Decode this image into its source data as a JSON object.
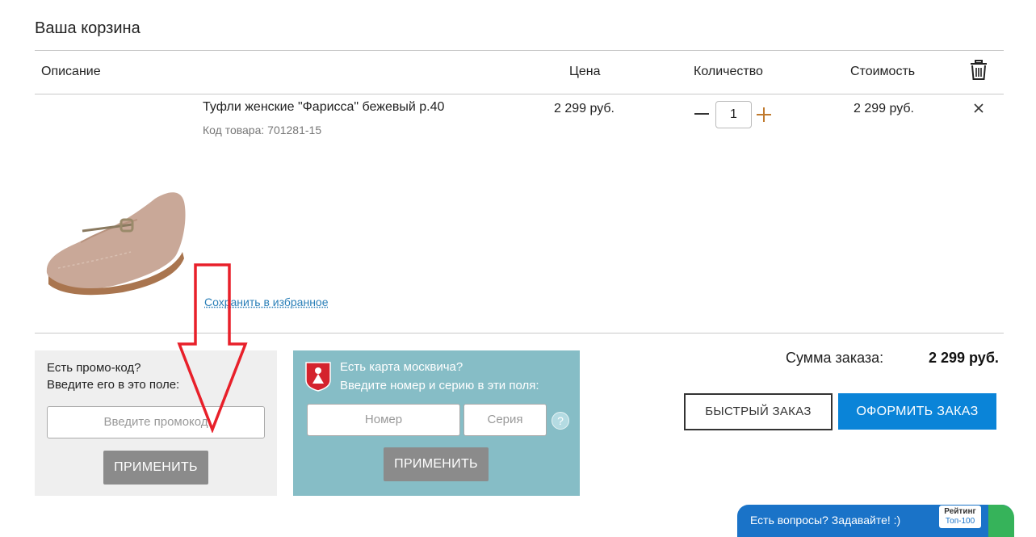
{
  "cart": {
    "title": "Ваша корзина",
    "columns": {
      "description": "Описание",
      "price": "Цена",
      "quantity": "Количество",
      "cost": "Стоимость"
    },
    "item": {
      "name": "Туфли женские \"Фарисса\" бежевый р.40",
      "code": "Код товара: 701281-15",
      "price": "2 299 руб.",
      "quantity": "1",
      "cost": "2 299 руб.",
      "save_to_favorites": "Сохранить в избранное"
    }
  },
  "promo": {
    "line1": "Есть промо-код?",
    "line2": "Введите его в это поле:",
    "placeholder": "Введите промокод",
    "apply": "ПРИМЕНИТЬ"
  },
  "muscovite_card": {
    "line1": "Есть карта москвича?",
    "line2": "Введите номер и серию в эти поля:",
    "number_placeholder": "Номер",
    "series_placeholder": "Серия",
    "help": "?",
    "apply": "ПРИМЕНИТЬ"
  },
  "summary": {
    "label": "Сумма заказа:",
    "value": "2 299 руб.",
    "quick_order": "БЫСТРЫЙ ЗАКАЗ",
    "checkout": "ОФОРМИТЬ ЗАКАЗ"
  },
  "chat": {
    "text": "Есть вопросы? Задавайте! :)",
    "rating_line1": "Рейтинг",
    "rating_line2": "Топ-100"
  },
  "icons": {
    "trash": "trash-icon",
    "remove": "close-icon",
    "plus": "plus-icon",
    "minus": "minus-icon",
    "help": "question-icon",
    "crest": "moscow-crest-icon",
    "annotation": "red-arrow-annotation"
  },
  "colors": {
    "accent_blue": "#0a84d8",
    "card_teal": "#86bdc6",
    "promo_bg": "#efefef",
    "apply_gray": "#8b8b8b",
    "plus_orange": "#c07a2e",
    "arrow_red": "#e8202a"
  }
}
